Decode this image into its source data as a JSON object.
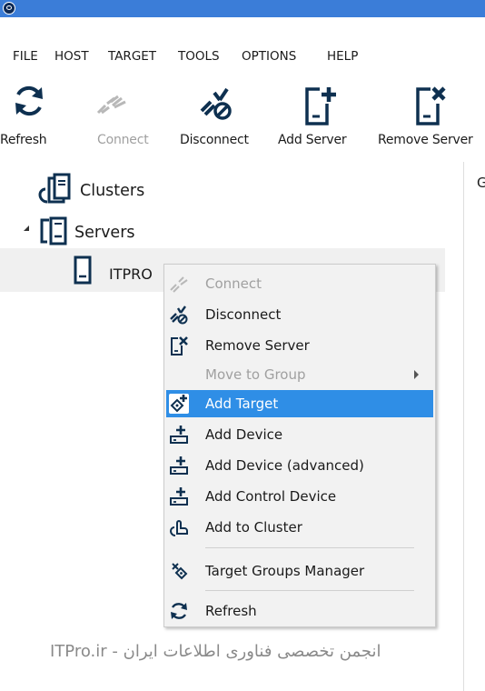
{
  "colors": {
    "titlebar": "#3b7dd8",
    "accent": "#2f8ee6",
    "icon_dark": "#0e3050",
    "disabled": "#a0a0a0"
  },
  "menubar": {
    "items": [
      "FILE",
      "HOST",
      "TARGET",
      "TOOLS",
      "OPTIONS",
      "HELP"
    ]
  },
  "toolbar": {
    "buttons": [
      {
        "label": "Refresh",
        "icon": "refresh-icon",
        "enabled": true
      },
      {
        "label": "Connect",
        "icon": "connect-icon",
        "enabled": false
      },
      {
        "label": "Disconnect",
        "icon": "disconnect-icon",
        "enabled": true
      },
      {
        "label": "Add Server",
        "icon": "add-server-icon",
        "enabled": true
      },
      {
        "label": "Remove Server",
        "icon": "remove-server-icon",
        "enabled": true
      }
    ]
  },
  "tree": {
    "clusters_label": "Clusters",
    "servers_label": "Servers",
    "server_name": "ITPRO"
  },
  "right_pane": {
    "tab_text": "G"
  },
  "context_menu": {
    "items": [
      {
        "label": "Connect",
        "icon": "connect-icon",
        "enabled": false
      },
      {
        "label": "Disconnect",
        "icon": "disconnect-icon",
        "enabled": true
      },
      {
        "label": "Remove Server",
        "icon": "remove-server-icon",
        "enabled": true
      },
      {
        "label": "Move to Group",
        "icon": "",
        "enabled": false,
        "submenu": true
      },
      {
        "label": "Add Target",
        "icon": "add-target-icon",
        "enabled": true,
        "highlighted": true
      },
      {
        "label": "Add Device",
        "icon": "add-device-icon",
        "enabled": true
      },
      {
        "label": "Add Device (advanced)",
        "icon": "add-device-advanced-icon",
        "enabled": true
      },
      {
        "label": "Add Control Device",
        "icon": "add-control-device-icon",
        "enabled": true
      },
      {
        "label": "Add to Cluster",
        "icon": "add-to-cluster-icon",
        "enabled": true
      },
      {
        "label": "Target Groups Manager",
        "icon": "target-groups-icon",
        "enabled": true
      },
      {
        "label": "Refresh",
        "icon": "refresh-icon",
        "enabled": true
      }
    ]
  },
  "watermark": {
    "text": "ITPro.ir - انجمن تخصصی فناوری اطلاعات ایران"
  }
}
